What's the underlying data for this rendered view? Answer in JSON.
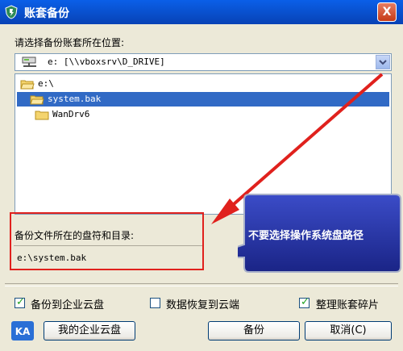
{
  "window": {
    "title": "账套备份",
    "close_label": "X"
  },
  "location_label": "请选择备份账套所在位置:",
  "drive_combo": {
    "value": "e: [\\\\vboxsrv\\D_DRIVE]",
    "icon": "network-drive-icon"
  },
  "folder_tree": [
    {
      "label": "e:\\",
      "selected": false
    },
    {
      "label": "system.bak",
      "selected": true
    },
    {
      "label": "WanDrv6",
      "selected": false
    }
  ],
  "directory_label": "备份文件所在的盘符和目录:",
  "directory_value": "e:\\system.bak",
  "annotation": {
    "text": "不要选择操作系统盘路径",
    "box_color": "#E0211D",
    "arrow_color": "#E0211D",
    "callout_color": "#1E2B9A"
  },
  "options": {
    "backup_to_cloud": {
      "label": "备份到企业云盘",
      "checked": true
    },
    "restore_to_cloud": {
      "label": "数据恢复到云端",
      "checked": false
    },
    "defragment": {
      "label": "整理账套碎片",
      "checked": true
    }
  },
  "buttons": {
    "my_cloud": "我的企业云盘",
    "backup": "备份",
    "cancel": "取消(C)"
  },
  "logo_text": "KA"
}
